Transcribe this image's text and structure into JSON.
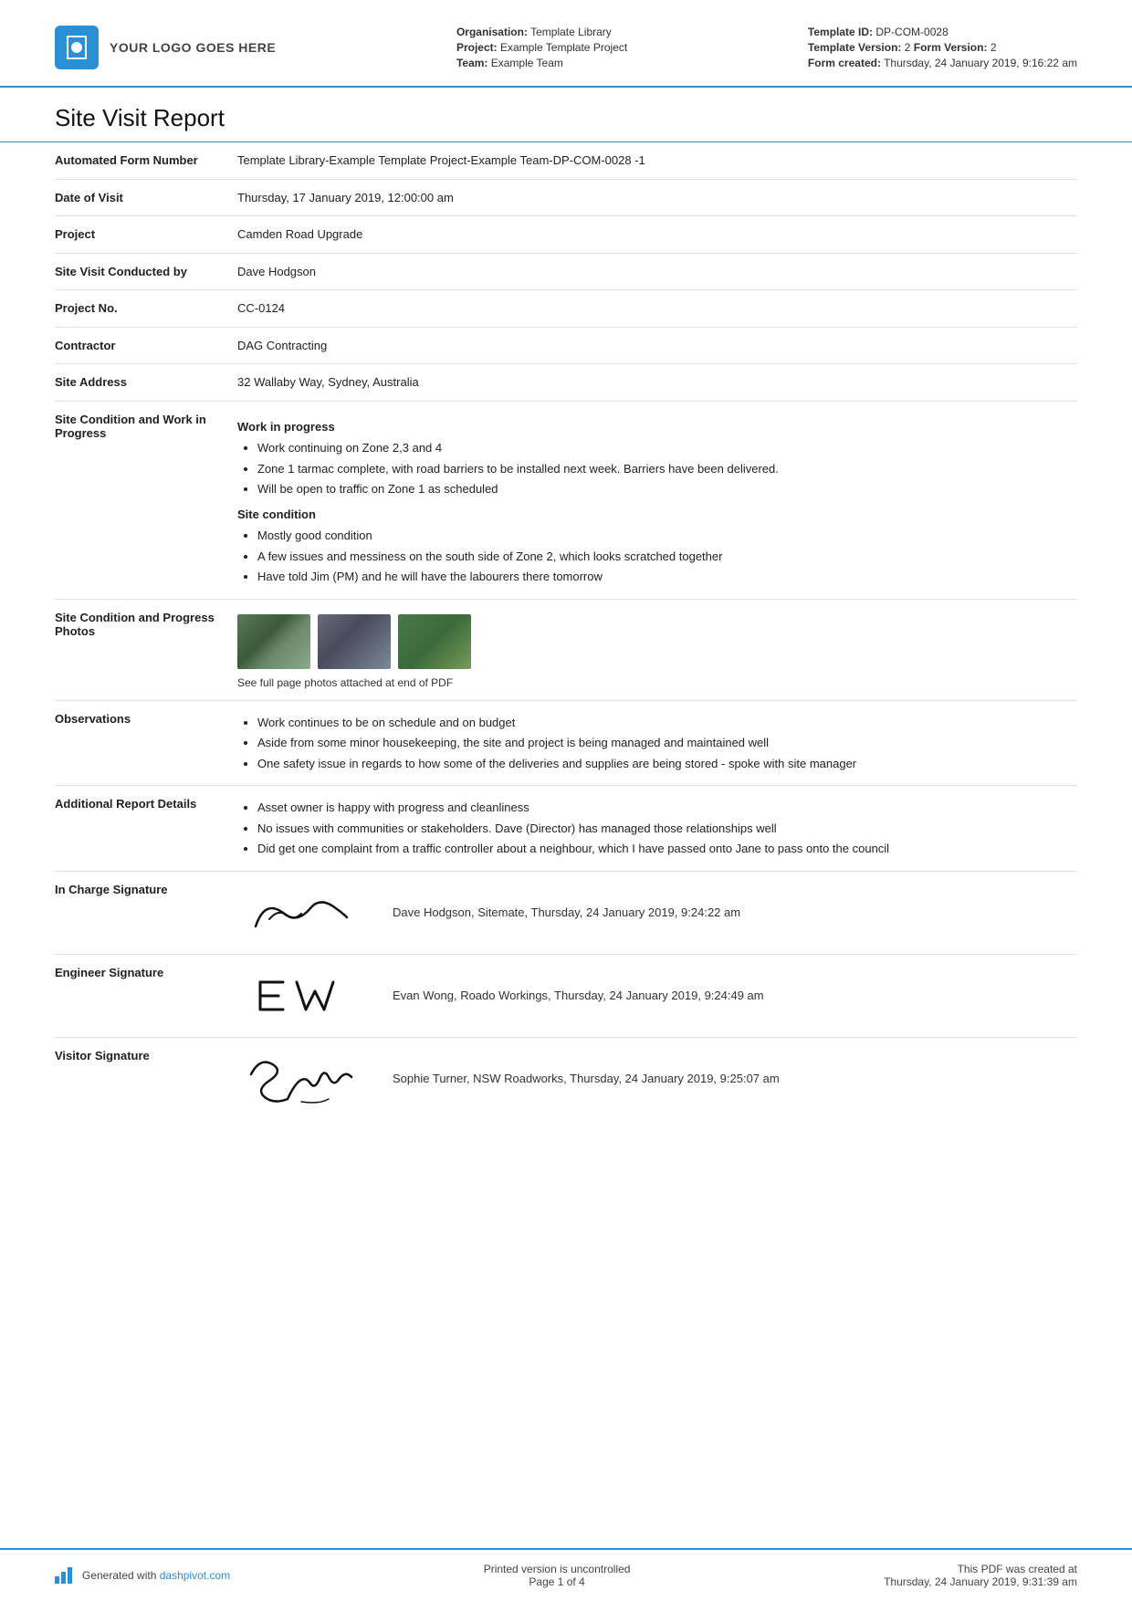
{
  "header": {
    "logo_text": "YOUR LOGO GOES HERE",
    "organisation_label": "Organisation:",
    "organisation_value": "Template Library",
    "project_label": "Project:",
    "project_value": "Example Template Project",
    "team_label": "Team:",
    "team_value": "Example Team",
    "template_id_label": "Template ID:",
    "template_id_value": "DP-COM-0028",
    "template_version_label": "Template Version:",
    "template_version_value": "2",
    "form_version_label": "Form Version:",
    "form_version_value": "2",
    "form_created_label": "Form created:",
    "form_created_value": "Thursday, 24 January 2019, 9:16:22 am"
  },
  "report": {
    "title": "Site Visit Report",
    "fields": [
      {
        "label": "Automated Form Number",
        "value": "Template Library-Example Template Project-Example Team-DP-COM-0028   -1"
      },
      {
        "label": "Date of Visit",
        "value": "Thursday, 17 January 2019, 12:00:00 am"
      },
      {
        "label": "Project",
        "value": "Camden Road Upgrade"
      },
      {
        "label": "Site Visit Conducted by",
        "value": "Dave Hodgson"
      },
      {
        "label": "Project No.",
        "value": "CC-0124"
      },
      {
        "label": "Contractor",
        "value": "DAG Contracting"
      },
      {
        "label": "Site Address",
        "value": "32 Wallaby Way, Sydney, Australia"
      }
    ],
    "site_condition_label": "Site Condition and Work in Progress",
    "site_condition_heading1": "Work in progress",
    "site_condition_bullets1": [
      "Work continuing on Zone 2,3 and 4",
      "Zone 1 tarmac complete, with road barriers to be installed next week. Barriers have been delivered.",
      "Will be open to traffic on Zone 1 as scheduled"
    ],
    "site_condition_heading2": "Site condition",
    "site_condition_bullets2": [
      "Mostly good condition",
      "A few issues and messiness on the south side of Zone 2, which looks scratched together",
      "Have told Jim (PM) and he will have the labourers there tomorrow"
    ],
    "photos_label": "Site Condition and Progress Photos",
    "photos_caption": "See full page photos attached at end of PDF",
    "observations_label": "Observations",
    "observations_bullets": [
      "Work continues to be on schedule and on budget",
      "Aside from some minor housekeeping, the site and project is being managed and maintained well",
      "One safety issue in regards to how some of the deliveries and supplies are being stored - spoke with site manager"
    ],
    "additional_label": "Additional Report Details",
    "additional_bullets": [
      "Asset owner is happy with progress and cleanliness",
      "No issues with communities or stakeholders. Dave (Director) has managed those relationships well",
      "Did get one complaint from a traffic controller about a neighbour, which I have passed onto Jane to pass onto the council"
    ],
    "sig1_label": "In Charge Signature",
    "sig1_text": "Dave Hodgson, Sitemate, Thursday, 24 January 2019, 9:24:22 am",
    "sig2_label": "Engineer Signature",
    "sig2_text": "Evan Wong, Roado Workings, Thursday, 24 January 2019, 9:24:49 am",
    "sig3_label": "Visitor Signature",
    "sig3_text": "Sophie Turner, NSW Roadworks, Thursday, 24 January 2019, 9:25:07 am"
  },
  "footer": {
    "generated_prefix": "Generated with",
    "generated_link": "dashpivot.com",
    "uncontrolled": "Printed version is uncontrolled",
    "page_label": "Page 1 of 4",
    "pdf_created_prefix": "This PDF was created at",
    "pdf_created_value": "Thursday, 24 January 2019, 9:31:39 am"
  }
}
